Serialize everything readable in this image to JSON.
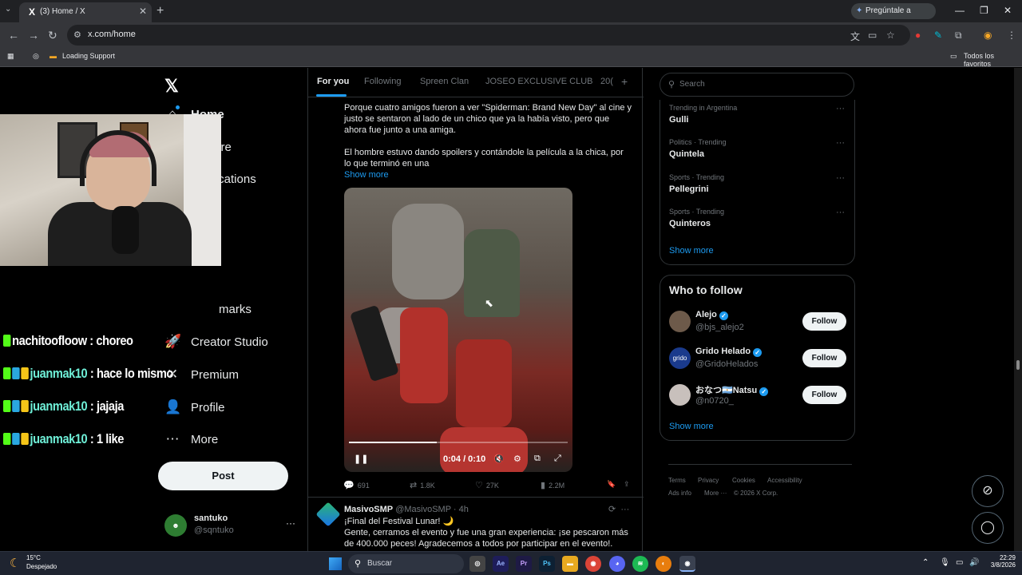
{
  "browser": {
    "tab_title": "(3) Home / X",
    "tab_favicon": "X",
    "gemini_label": "Pregúntale a Gemini",
    "url": "x.com/home",
    "bookmarks": {
      "loading_support": "Loading Support",
      "all_favorites": "Todos los favoritos"
    }
  },
  "nav": {
    "logo": "𝕏",
    "items": [
      {
        "label": "Home",
        "icon": "home-icon",
        "glyph": "⌂"
      },
      {
        "label": "Explore",
        "icon": "search-icon",
        "glyph": "⚲"
      },
      {
        "label": "Notifications",
        "icon": "bell-icon",
        "glyph": "🔔"
      },
      {
        "label": "Bookmarks",
        "icon": "bookmark-icon",
        "glyph": "🔖"
      },
      {
        "label": "Creator Studio",
        "icon": "rocket-icon",
        "glyph": "🚀"
      },
      {
        "label": "Premium",
        "icon": "premium-icon",
        "glyph": "✕"
      },
      {
        "label": "Profile",
        "icon": "person-icon",
        "glyph": "👤"
      },
      {
        "label": "More",
        "icon": "more-icon",
        "glyph": "⋯"
      }
    ],
    "partial_bookmarks": "marks",
    "notification_badge": "3",
    "post_label": "Post",
    "account": {
      "name": "santuko",
      "handle": "@sqntuko"
    }
  },
  "timeline": {
    "tabs": [
      "For you",
      "Following",
      "Spreen Clan",
      "JOSEO EXCLUSIVE CLUB",
      "20("
    ],
    "tweet1": {
      "paragraph1": "Porque cuatro amigos fueron a ver \"Spiderman: Brand New Day\" al cine y justo se sentaron al lado de un chico que ya la había visto, pero que ahora fue junto a una amiga.",
      "paragraph2": "El hombre estuvo dando spoilers y contándole la película a la chica, por lo que terminó en una",
      "show_more": "Show more",
      "video_time": "0:04 / 0:10",
      "video_progress": 0.4,
      "replies": "691",
      "reposts": "1.8K",
      "likes": "27K",
      "views": "2.2M"
    },
    "tweet2": {
      "name": "MasivoSMP",
      "handle": "@MasivoSMP",
      "time": "· 4h",
      "line1": "¡Final del Festival Lunar! 🌙",
      "line2": "Gente, cerramos el evento y fue una gran experiencia: ¡se pescaron más de 400.000 peces! Agradecemos a todos por participar en el evento!."
    }
  },
  "sidebar": {
    "search_placeholder": "Search",
    "trends": [
      {
        "context": "Trending in Argentina",
        "name": "Gulli"
      },
      {
        "context": "Politics · Trending",
        "name": "Quintela"
      },
      {
        "context": "Sports · Trending",
        "name": "Pellegrini"
      },
      {
        "context": "Sports · Trending",
        "name": "Quinteros"
      }
    ],
    "show_more": "Show more",
    "who_to_follow_title": "Who to follow",
    "follow": [
      {
        "name": "Alejo",
        "handle": "@bjs_alejo2",
        "avatar_text": ""
      },
      {
        "name": "Grido Helado",
        "handle": "@GridoHelados",
        "avatar_text": "grido"
      },
      {
        "name": "おなつ🇦🇷Natsu",
        "handle": "@n0720_",
        "avatar_text": ""
      }
    ],
    "follow_label": "Follow",
    "footer": {
      "terms": "Terms",
      "privacy": "Privacy",
      "cookies": "Cookies",
      "accessibility": "Accessibility",
      "ads": "Ads info",
      "more": "More ···",
      "copyright": "© 2026 X Corp."
    }
  },
  "stream_chat": [
    {
      "user": "nachitoofloow",
      "msg": " : choreo"
    },
    {
      "user": "juanmak10",
      "msg": " : hace lo mismo"
    },
    {
      "user": "juanmak10",
      "msg": " : jajaja"
    },
    {
      "user": "juanmak10",
      "msg": " : 1 like"
    }
  ],
  "taskbar": {
    "temperature": "15°C",
    "condition": "Despejado",
    "search_placeholder": "Buscar",
    "time": "22:29",
    "date": "3/8/2026"
  }
}
